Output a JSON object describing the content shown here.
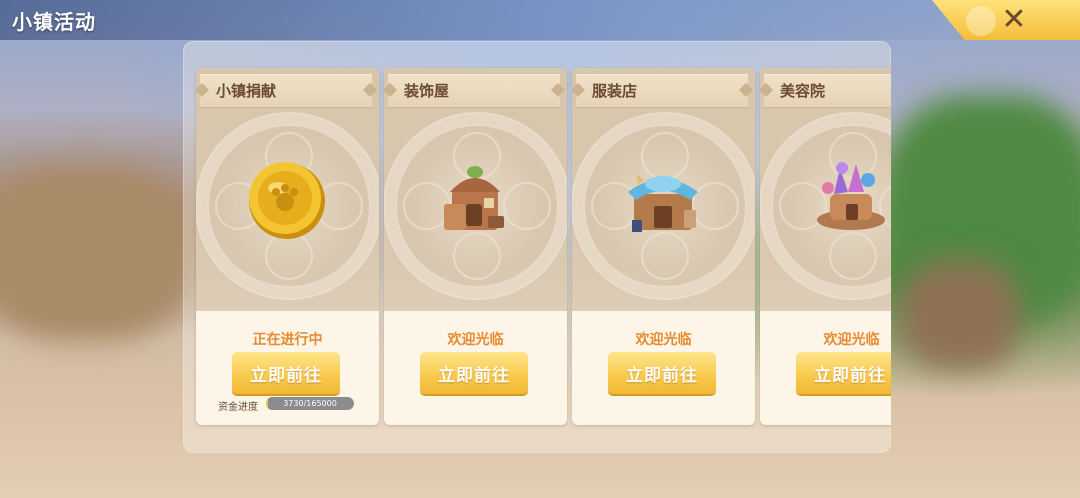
{
  "title": "小镇活动",
  "close_icon": "close-x-icon",
  "colors": {
    "status_text": "#e58a2e",
    "button": "#f8c84a",
    "card_name": "#6b4a32"
  },
  "cards": [
    {
      "name": "小镇捐献",
      "icon": "gold-coin-icon",
      "status": "正在进行中",
      "button_label": "立即前往",
      "progress_label": "资金进度",
      "progress_text": "3730/165000",
      "progress_current": 3730,
      "progress_total": 165000
    },
    {
      "name": "装饰屋",
      "icon": "decoration-house-icon",
      "status": "欢迎光临",
      "button_label": "立即前往"
    },
    {
      "name": "服装店",
      "icon": "clothing-shop-icon",
      "status": "欢迎光临",
      "button_label": "立即前往"
    },
    {
      "name": "美容院",
      "icon": "beauty-salon-icon",
      "status": "欢迎光临",
      "button_label": "立即前往"
    }
  ]
}
